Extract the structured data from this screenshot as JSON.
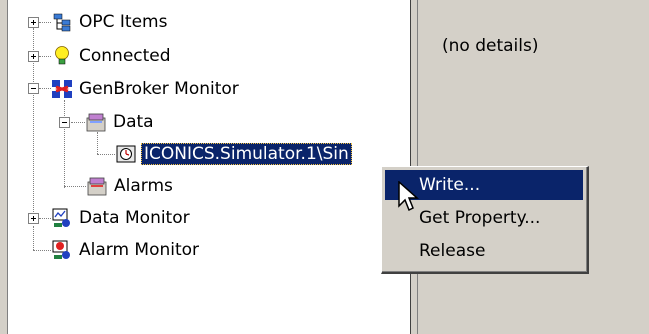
{
  "tree": {
    "items": [
      {
        "label": "OPC Items",
        "icon": "opc-items-icon"
      },
      {
        "label": "Connected",
        "icon": "lightbulb-icon"
      },
      {
        "label": "GenBroker Monitor",
        "icon": "network-monitor-icon"
      },
      {
        "label": "Data",
        "icon": "folder-data-icon"
      },
      {
        "label": "ICONICS.Simulator.1\\Sin",
        "icon": "tag-item-icon"
      },
      {
        "label": "Alarms",
        "icon": "folder-alarms-icon"
      },
      {
        "label": "Data Monitor",
        "icon": "data-monitor-icon"
      },
      {
        "label": "Alarm Monitor",
        "icon": "alarm-monitor-icon"
      }
    ]
  },
  "details": {
    "text": "(no details)"
  },
  "context_menu": {
    "items": [
      {
        "label": "Write..."
      },
      {
        "label": "Get Property..."
      },
      {
        "label": "Release"
      }
    ]
  },
  "colors": {
    "selection": "#0a246a",
    "panel": "#d4d0c8"
  }
}
